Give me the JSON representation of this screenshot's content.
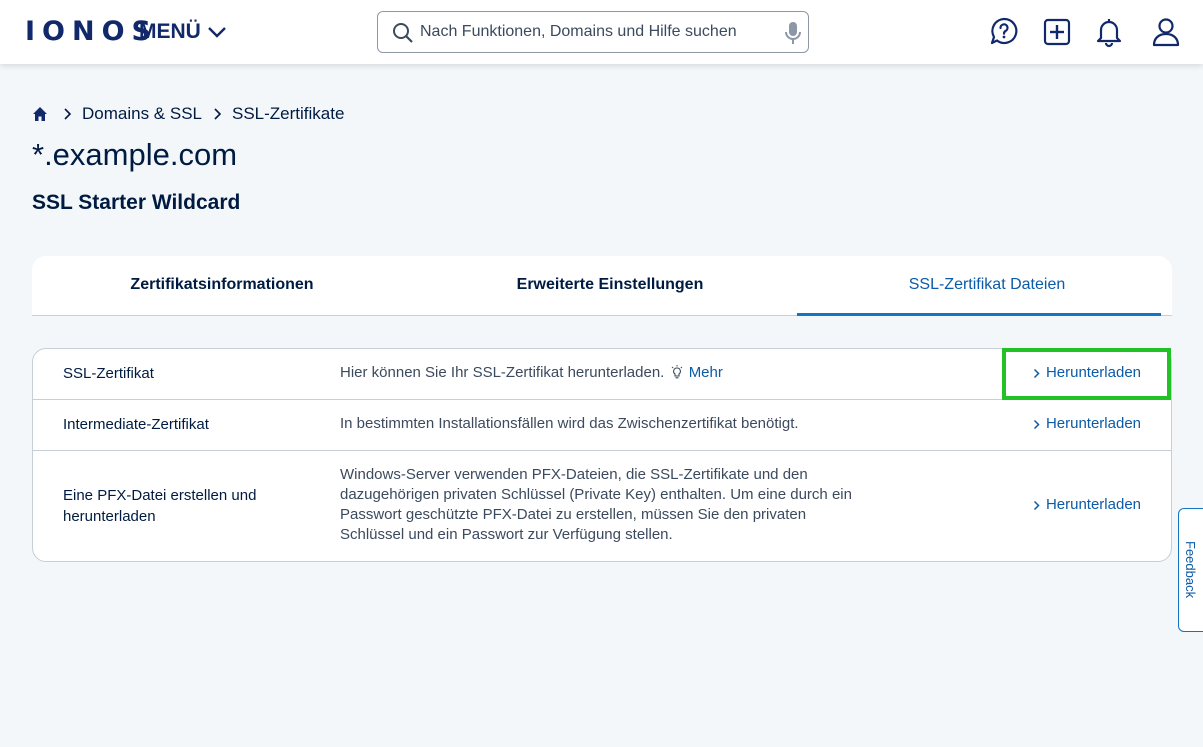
{
  "header": {
    "logo": "IONOS",
    "menu_label": "MENÜ",
    "search_placeholder": "Nach Funktionen, Domains und Hilfe suchen",
    "icons": [
      "help-chat-icon",
      "plus-square-icon",
      "bell-icon",
      "user-icon"
    ]
  },
  "breadcrumb": {
    "items": [
      "Domains & SSL",
      "SSL-Zertifikate"
    ]
  },
  "page": {
    "title": "*.example.com",
    "subtitle": "SSL Starter Wildcard"
  },
  "tabs": [
    {
      "label": "Zertifikatsinformationen",
      "active": false
    },
    {
      "label": "Erweiterte Einstellungen",
      "active": false
    },
    {
      "label": "SSL-Zertifikat Dateien",
      "active": true
    }
  ],
  "files": [
    {
      "name": "SSL-Zertifikat",
      "description": "Hier können Sie Ihr SSL-Zertifikat herunterladen.",
      "more_label": "Mehr",
      "action": "Herunterladen"
    },
    {
      "name": "Intermediate-Zertifikat",
      "description": "In bestimmten Installationsfällen wird das Zwischenzertifikat benötigt.",
      "action": "Herunterladen"
    },
    {
      "name": "Eine PFX-Datei erstellen und herunterladen",
      "description": "Windows-Server verwenden PFX-Dateien, die SSL-Zertifikate und den dazugehörigen privaten Schlüssel (Private Key) enthalten. Um eine durch ein Passwort geschützte PFX-Datei zu erstellen, müssen Sie den privaten Schlüssel und ein Passwort zur Verfügung stellen.",
      "action": "Herunterladen"
    }
  ],
  "feedback_label": "Feedback",
  "colors": {
    "brand": "#11296b",
    "link": "#0b5ba8",
    "highlight": "#22c226",
    "background": "#f4f7fa"
  }
}
